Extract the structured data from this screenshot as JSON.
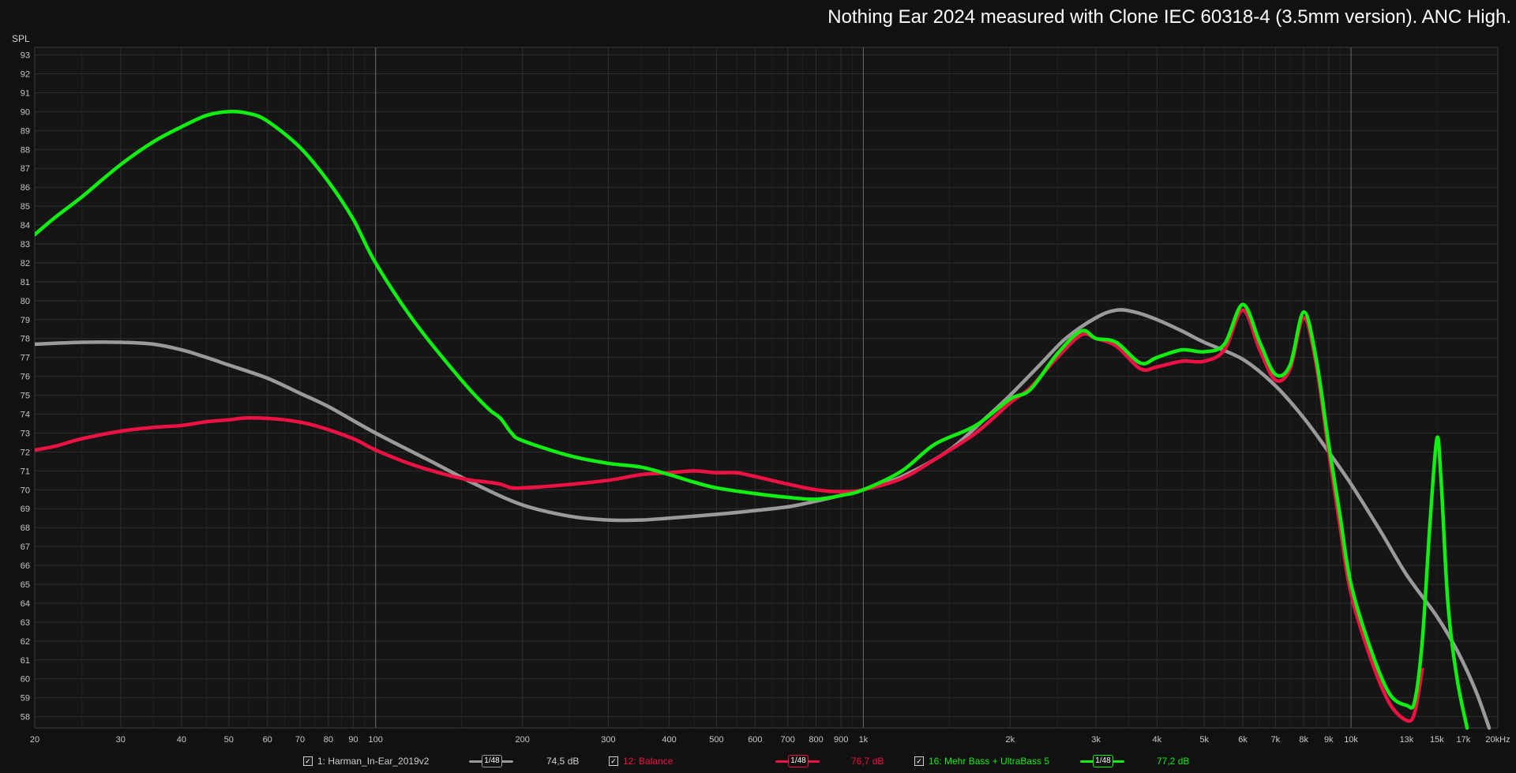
{
  "title": "Nothing Ear 2024 measured with Clone IEC 60318-4 (3.5mm version). ANC High.",
  "colors": {
    "background": "#111111",
    "grid_major": "#5a5a5a",
    "grid_minor": "#2e2e2e",
    "harman": "#9a9a9a",
    "balance": "#ee1144",
    "bass": "#11ee11"
  },
  "legend": [
    {
      "check": "✓",
      "label": "1: Harman_In-Ear_2019v2",
      "smoothing": "1/48",
      "level": "74,5 dB",
      "color": "#9a9a9a"
    },
    {
      "check": "✓",
      "label": "12: Balance",
      "smoothing": "1/48",
      "level": "76,7 dB",
      "color": "#ee1144"
    },
    {
      "check": "✓",
      "label": "16: Mehr Bass + UltraBass 5",
      "smoothing": "1/48",
      "level": "77,2 dB",
      "color": "#11ee11"
    }
  ],
  "chart_data": {
    "type": "line",
    "title": "Nothing Ear 2024 measured with Clone IEC 60318-4 (3.5mm version). ANC High.",
    "ylabel": "SPL",
    "xlabel": "",
    "xscale": "log",
    "xlim": [
      20,
      20000
    ],
    "ylim": [
      57.4,
      93.4
    ],
    "grid": true,
    "y_ticks": [
      58,
      59,
      60,
      61,
      62,
      63,
      64,
      65,
      66,
      67,
      68,
      69,
      70,
      71,
      72,
      73,
      74,
      75,
      76,
      77,
      78,
      79,
      80,
      81,
      82,
      83,
      84,
      85,
      86,
      87,
      88,
      89,
      90,
      91,
      92,
      93
    ],
    "x_tick_labels": [
      {
        "x": 20,
        "label": "20"
      },
      {
        "x": 30,
        "label": "30"
      },
      {
        "x": 40,
        "label": "40"
      },
      {
        "x": 50,
        "label": "50"
      },
      {
        "x": 60,
        "label": "60"
      },
      {
        "x": 70,
        "label": "70"
      },
      {
        "x": 80,
        "label": "80"
      },
      {
        "x": 90,
        "label": "90"
      },
      {
        "x": 100,
        "label": "100"
      },
      {
        "x": 200,
        "label": "200"
      },
      {
        "x": 300,
        "label": "300"
      },
      {
        "x": 400,
        "label": "400"
      },
      {
        "x": 500,
        "label": "500"
      },
      {
        "x": 600,
        "label": "600"
      },
      {
        "x": 700,
        "label": "700"
      },
      {
        "x": 800,
        "label": "800"
      },
      {
        "x": 900,
        "label": "900"
      },
      {
        "x": 1000,
        "label": "1k"
      },
      {
        "x": 2000,
        "label": "2k"
      },
      {
        "x": 3000,
        "label": "3k"
      },
      {
        "x": 4000,
        "label": "4k"
      },
      {
        "x": 5000,
        "label": "5k"
      },
      {
        "x": 6000,
        "label": "6k"
      },
      {
        "x": 7000,
        "label": "7k"
      },
      {
        "x": 8000,
        "label": "8k"
      },
      {
        "x": 9000,
        "label": "9k"
      },
      {
        "x": 10000,
        "label": "10k"
      },
      {
        "x": 13000,
        "label": "13k"
      },
      {
        "x": 15000,
        "label": "15k"
      },
      {
        "x": 17000,
        "label": "17k"
      },
      {
        "x": 20000,
        "label": "20kHz"
      }
    ],
    "series": [
      {
        "name": "1: Harman_In-Ear_2019v2",
        "color": "#9a9a9a",
        "points": [
          [
            20,
            77.7
          ],
          [
            25,
            77.8
          ],
          [
            30,
            77.8
          ],
          [
            35,
            77.7
          ],
          [
            40,
            77.4
          ],
          [
            45,
            77.0
          ],
          [
            50,
            76.6
          ],
          [
            60,
            75.9
          ],
          [
            70,
            75.1
          ],
          [
            80,
            74.4
          ],
          [
            100,
            73.0
          ],
          [
            130,
            71.5
          ],
          [
            160,
            70.3
          ],
          [
            200,
            69.2
          ],
          [
            250,
            68.6
          ],
          [
            300,
            68.4
          ],
          [
            350,
            68.4
          ],
          [
            400,
            68.5
          ],
          [
            500,
            68.7
          ],
          [
            600,
            68.9
          ],
          [
            700,
            69.1
          ],
          [
            800,
            69.4
          ],
          [
            900,
            69.7
          ],
          [
            1000,
            70.0
          ],
          [
            1200,
            70.7
          ],
          [
            1500,
            72.1
          ],
          [
            1800,
            73.9
          ],
          [
            2000,
            75.0
          ],
          [
            2300,
            76.6
          ],
          [
            2600,
            78.0
          ],
          [
            3000,
            79.1
          ],
          [
            3300,
            79.5
          ],
          [
            3600,
            79.4
          ],
          [
            4000,
            79.0
          ],
          [
            4500,
            78.4
          ],
          [
            5000,
            77.8
          ],
          [
            6000,
            76.9
          ],
          [
            7000,
            75.5
          ],
          [
            8000,
            73.8
          ],
          [
            9000,
            72.0
          ],
          [
            10000,
            70.3
          ],
          [
            11500,
            67.8
          ],
          [
            13000,
            65.5
          ],
          [
            15000,
            63.3
          ],
          [
            16500,
            61.5
          ],
          [
            18000,
            59.4
          ],
          [
            19200,
            57.4
          ]
        ]
      },
      {
        "name": "12: Balance",
        "color": "#ee1144",
        "points": [
          [
            20,
            72.1
          ],
          [
            22,
            72.3
          ],
          [
            25,
            72.7
          ],
          [
            30,
            73.1
          ],
          [
            35,
            73.3
          ],
          [
            40,
            73.4
          ],
          [
            45,
            73.6
          ],
          [
            50,
            73.7
          ],
          [
            55,
            73.8
          ],
          [
            65,
            73.7
          ],
          [
            75,
            73.4
          ],
          [
            90,
            72.7
          ],
          [
            100,
            72.1
          ],
          [
            120,
            71.3
          ],
          [
            150,
            70.6
          ],
          [
            170,
            70.4
          ],
          [
            180,
            70.3
          ],
          [
            190,
            70.1
          ],
          [
            200,
            70.1
          ],
          [
            230,
            70.2
          ],
          [
            300,
            70.5
          ],
          [
            350,
            70.8
          ],
          [
            400,
            70.9
          ],
          [
            450,
            71.0
          ],
          [
            500,
            70.9
          ],
          [
            550,
            70.9
          ],
          [
            600,
            70.7
          ],
          [
            700,
            70.3
          ],
          [
            800,
            70.0
          ],
          [
            900,
            69.9
          ],
          [
            1000,
            70.0
          ],
          [
            1200,
            70.6
          ],
          [
            1400,
            71.6
          ],
          [
            1700,
            73.0
          ],
          [
            2000,
            74.6
          ],
          [
            2200,
            75.4
          ],
          [
            2500,
            77.0
          ],
          [
            2800,
            78.2
          ],
          [
            3000,
            78.0
          ],
          [
            3300,
            77.6
          ],
          [
            3700,
            76.4
          ],
          [
            4000,
            76.5
          ],
          [
            4500,
            76.8
          ],
          [
            5000,
            76.8
          ],
          [
            5500,
            77.4
          ],
          [
            6000,
            79.5
          ],
          [
            6500,
            77.4
          ],
          [
            7000,
            75.8
          ],
          [
            7500,
            76.4
          ],
          [
            8000,
            79.1
          ],
          [
            8500,
            76.5
          ],
          [
            9000,
            72.0
          ],
          [
            9500,
            68.0
          ],
          [
            10000,
            64.5
          ],
          [
            11000,
            61.0
          ],
          [
            12000,
            58.7
          ],
          [
            13000,
            57.8
          ],
          [
            13500,
            58.2
          ],
          [
            14000,
            60.5
          ]
        ]
      },
      {
        "name": "16: Mehr Bass + UltraBass 5",
        "color": "#11ee11",
        "points": [
          [
            20,
            83.5
          ],
          [
            22,
            84.4
          ],
          [
            25,
            85.5
          ],
          [
            30,
            87.2
          ],
          [
            35,
            88.4
          ],
          [
            40,
            89.2
          ],
          [
            45,
            89.8
          ],
          [
            50,
            90.0
          ],
          [
            55,
            89.9
          ],
          [
            60,
            89.5
          ],
          [
            70,
            88.1
          ],
          [
            80,
            86.3
          ],
          [
            90,
            84.3
          ],
          [
            100,
            82.0
          ],
          [
            120,
            78.9
          ],
          [
            150,
            75.8
          ],
          [
            170,
            74.3
          ],
          [
            180,
            73.8
          ],
          [
            190,
            73.0
          ],
          [
            200,
            72.6
          ],
          [
            250,
            71.8
          ],
          [
            300,
            71.4
          ],
          [
            350,
            71.2
          ],
          [
            400,
            70.8
          ],
          [
            450,
            70.4
          ],
          [
            500,
            70.1
          ],
          [
            600,
            69.8
          ],
          [
            700,
            69.6
          ],
          [
            800,
            69.5
          ],
          [
            900,
            69.7
          ],
          [
            1000,
            70.0
          ],
          [
            1200,
            71.0
          ],
          [
            1400,
            72.4
          ],
          [
            1700,
            73.4
          ],
          [
            2000,
            74.8
          ],
          [
            2200,
            75.3
          ],
          [
            2500,
            77.2
          ],
          [
            2800,
            78.4
          ],
          [
            3000,
            78.0
          ],
          [
            3300,
            77.8
          ],
          [
            3700,
            76.7
          ],
          [
            4000,
            77.0
          ],
          [
            4500,
            77.4
          ],
          [
            5000,
            77.3
          ],
          [
            5500,
            77.7
          ],
          [
            6000,
            79.8
          ],
          [
            6500,
            77.8
          ],
          [
            7000,
            76.1
          ],
          [
            7500,
            76.6
          ],
          [
            8000,
            79.4
          ],
          [
            8500,
            76.8
          ],
          [
            9000,
            72.4
          ],
          [
            9500,
            68.6
          ],
          [
            10000,
            65.0
          ],
          [
            11000,
            61.5
          ],
          [
            12000,
            59.2
          ],
          [
            13000,
            58.6
          ],
          [
            13500,
            58.8
          ],
          [
            14000,
            62.0
          ],
          [
            14500,
            68.0
          ],
          [
            15000,
            72.7
          ],
          [
            15300,
            70.5
          ],
          [
            15800,
            64.0
          ],
          [
            16500,
            60.0
          ],
          [
            17300,
            57.4
          ]
        ]
      }
    ]
  }
}
